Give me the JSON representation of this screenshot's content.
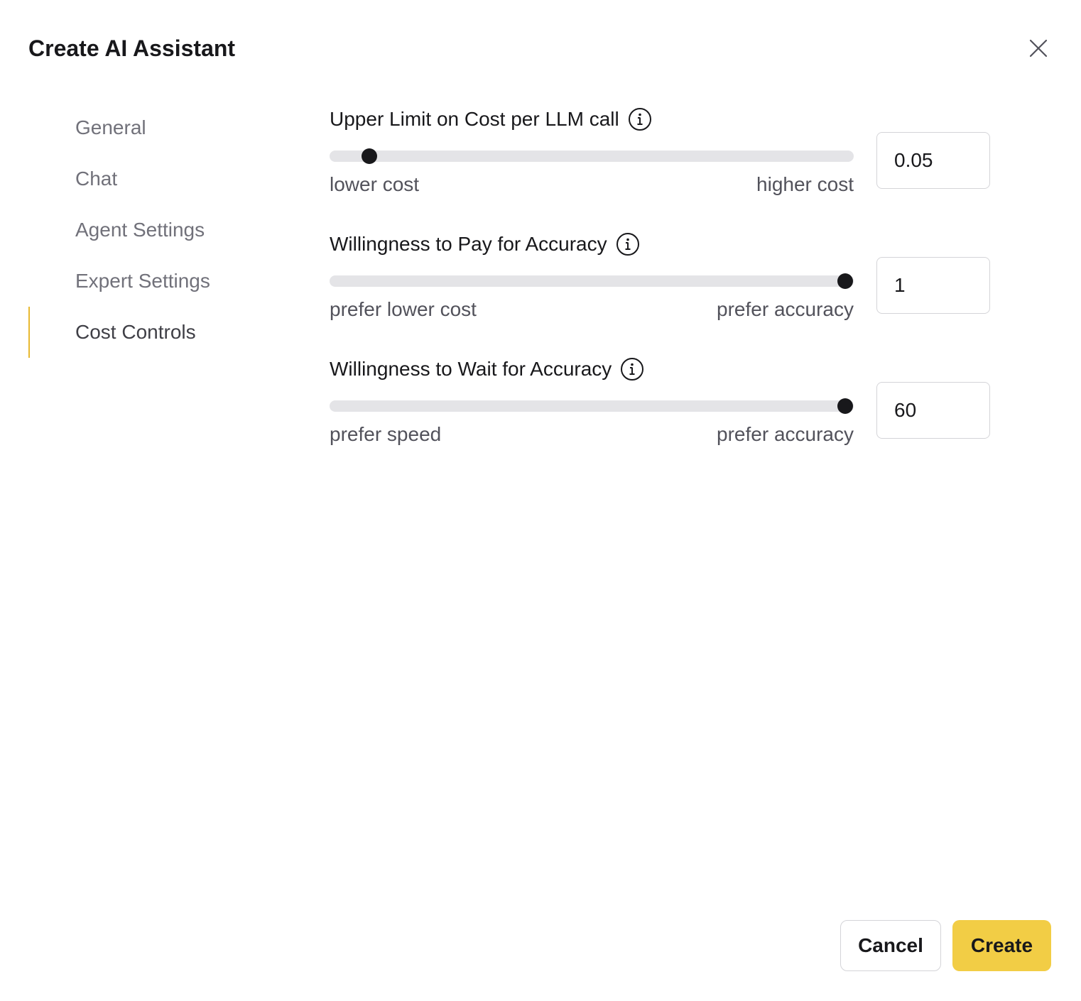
{
  "dialog": {
    "title": "Create AI Assistant"
  },
  "sidebar": {
    "items": [
      {
        "label": "General",
        "active": false
      },
      {
        "label": "Chat",
        "active": false
      },
      {
        "label": "Agent Settings",
        "active": false
      },
      {
        "label": "Expert Settings",
        "active": false
      },
      {
        "label": "Cost Controls",
        "active": true
      }
    ]
  },
  "settings": [
    {
      "title": "Upper Limit on Cost per LLM call",
      "min_label": "lower cost",
      "max_label": "higher cost",
      "value": "0.05",
      "slider_fraction": 0.06
    },
    {
      "title": "Willingness to Pay for Accuracy",
      "min_label": "prefer lower cost",
      "max_label": "prefer accuracy",
      "value": "1",
      "slider_fraction": 1.0
    },
    {
      "title": "Willingness to Wait for Accuracy",
      "min_label": "prefer speed",
      "max_label": "prefer accuracy",
      "value": "60",
      "slider_fraction": 1.0
    }
  ],
  "footer": {
    "cancel_label": "Cancel",
    "create_label": "Create"
  },
  "colors": {
    "accent": "#f2cd45",
    "active_indicator": "#e8b931"
  },
  "icons": {
    "close": "close-icon",
    "info": "info-icon"
  }
}
